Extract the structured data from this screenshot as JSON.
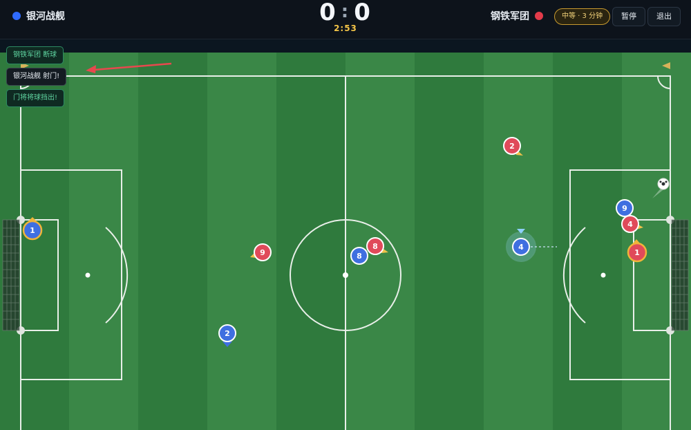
{
  "header": {
    "home": {
      "name": "银河战舰",
      "color": "#2f6bff"
    },
    "away": {
      "name": "钢铁军团",
      "color": "#e23b4a"
    },
    "score_home": "0",
    "score_sep": ":",
    "score_away": "0",
    "clock": "2:53",
    "difficulty": "中等 · 3 分钟",
    "pause_label": "暂停",
    "exit_label": "退出"
  },
  "event_log": [
    {
      "text": "钢铁军团 断球",
      "style": "green"
    },
    {
      "text": "银河战舰 射门!",
      "style": "dark"
    },
    {
      "text": "门将将球挡出!",
      "style": "green"
    }
  ],
  "players": [
    {
      "team": "blue",
      "number": "1",
      "role": "goalkeeper"
    },
    {
      "team": "blue",
      "number": "2"
    },
    {
      "team": "blue",
      "number": "8"
    },
    {
      "team": "blue",
      "number": "4",
      "selected": true
    },
    {
      "team": "blue",
      "number": "9"
    },
    {
      "team": "red",
      "number": "9"
    },
    {
      "team": "red",
      "number": "8"
    },
    {
      "team": "red",
      "number": "2"
    },
    {
      "team": "red",
      "number": "4"
    },
    {
      "team": "red",
      "number": "1",
      "role": "goalkeeper"
    }
  ],
  "colors": {
    "pitch_light": "#3d8a4a",
    "pitch_dark": "#2f7a3d",
    "line": "#e9efe9",
    "blue_player": "#3f6fe0",
    "red_player": "#e04a5a",
    "goalkeeper_ring": "#f0b43a",
    "ball": "#ffffff"
  }
}
